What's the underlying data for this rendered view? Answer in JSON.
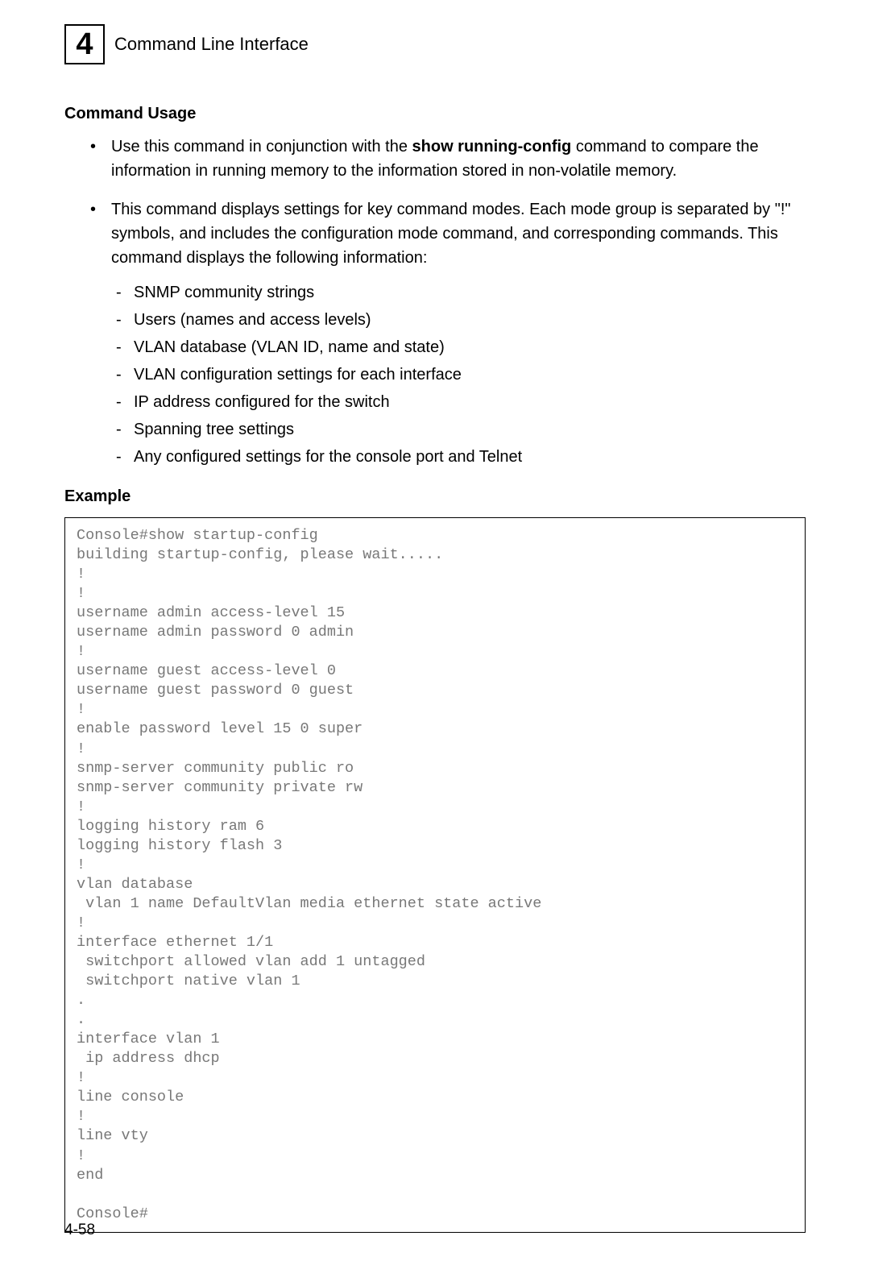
{
  "header": {
    "chapter_number": "4",
    "title": "Command Line Interface"
  },
  "sections": {
    "command_usage": {
      "heading": "Command Usage",
      "bullets": {
        "b1_pre": "Use this command in conjunction with the ",
        "b1_bold": "show running-config",
        "b1_post": " command to compare the information in running memory to the information stored in non-volatile memory.",
        "b2_text": "This command displays settings for key command modes. Each mode group is separated by \"!\" symbols, and includes the configuration mode command, and corresponding commands. This command displays the following information:",
        "sub": {
          "s1": "SNMP community strings",
          "s2": "Users (names and access levels)",
          "s3": "VLAN database (VLAN ID, name and state)",
          "s4": "VLAN configuration settings for each interface",
          "s5": "IP address configured for the switch",
          "s6": "Spanning tree settings",
          "s7": "Any configured settings for the console port and Telnet"
        }
      }
    },
    "example": {
      "heading": "Example",
      "code": "Console#show startup-config\nbuilding startup-config, please wait.....\n!\n!\nusername admin access-level 15\nusername admin password 0 admin\n!\nusername guest access-level 0\nusername guest password 0 guest\n!\nenable password level 15 0 super\n!\nsnmp-server community public ro\nsnmp-server community private rw\n!\nlogging history ram 6\nlogging history flash 3\n!\nvlan database\n vlan 1 name DefaultVlan media ethernet state active\n!\ninterface ethernet 1/1\n switchport allowed vlan add 1 untagged\n switchport native vlan 1\n.\n.\ninterface vlan 1\n ip address dhcp\n!\nline console\n!\nline vty\n!\nend\n\nConsole#"
    }
  },
  "page_number": "4-58"
}
